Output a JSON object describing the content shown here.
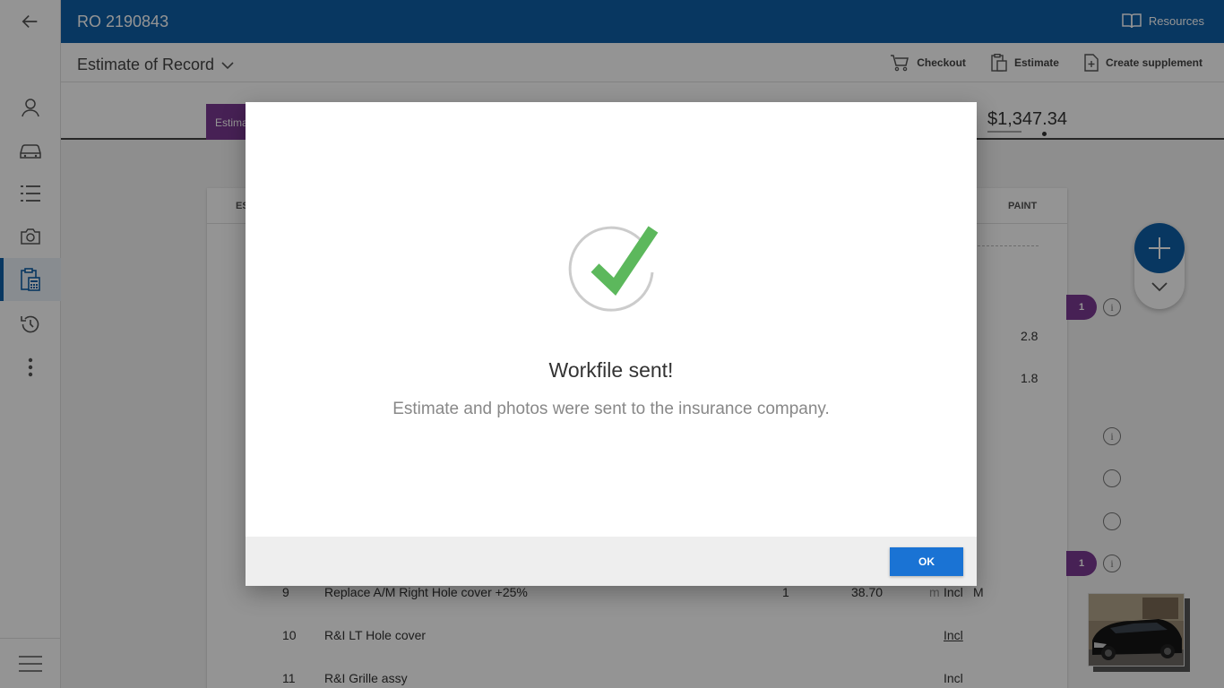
{
  "topbar": {
    "ro_number": "RO 2190843",
    "resources_label": "Resources"
  },
  "subbar": {
    "title": "Estimate of Record",
    "checkout_label": "Checkout",
    "estimate_label": "Estimate",
    "create_supplement_label": "Create supplement"
  },
  "strip": {
    "tag_label": "Estima",
    "total": "$1,347.34"
  },
  "table": {
    "header_es": "ES",
    "header_paint": "PAINT",
    "paint_values": [
      "2.8",
      "1.8"
    ],
    "rows": [
      {
        "line": "9",
        "description": "Replace A/M Right Hole cover +25%",
        "qty": "1",
        "price": "38.70",
        "flag": "m",
        "labor": "Incl",
        "labor_type": "M"
      },
      {
        "line": "10",
        "description": "R&I LT Hole cover",
        "qty": "",
        "price": "",
        "flag": "",
        "labor": "Incl",
        "labor_type": ""
      },
      {
        "line": "11",
        "description": "R&I Grille assy",
        "qty": "",
        "price": "",
        "flag": "",
        "labor": "Incl",
        "labor_type": ""
      }
    ]
  },
  "badges": [
    "1",
    "1"
  ],
  "info_glyph": "i",
  "modal": {
    "title": "Workfile sent!",
    "message": "Estimate and photos were sent to the insurance company.",
    "ok_label": "OK"
  },
  "colors": {
    "primary": "#0f5fa8",
    "purple": "#7b3a93",
    "success": "#5cb85c",
    "ok_button": "#1a73d4"
  }
}
